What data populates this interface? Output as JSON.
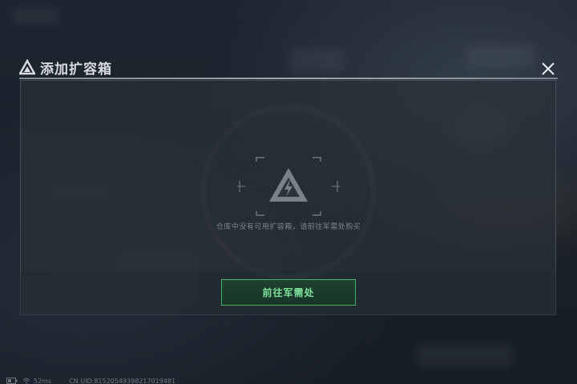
{
  "dialog": {
    "title": "添加扩容箱",
    "empty_message": "仓库中没有可用扩容箱，请前往军需处购买",
    "goto_button_label": "前往军需处"
  },
  "icons": {
    "title_icon": "triangle-logo-icon",
    "close_icon": "close-icon",
    "empty_state_icon": "triangle-lightning-icon",
    "battery_icon": "battery-icon",
    "wifi_icon": "wifi-icon"
  },
  "status_bar": {
    "ping": "52ms",
    "uid": "CN UID:8152054939821701948​1"
  },
  "colors": {
    "accent_green": "#3db46a",
    "button_text_green": "#7ee29c",
    "title_text": "#d9dde2"
  }
}
